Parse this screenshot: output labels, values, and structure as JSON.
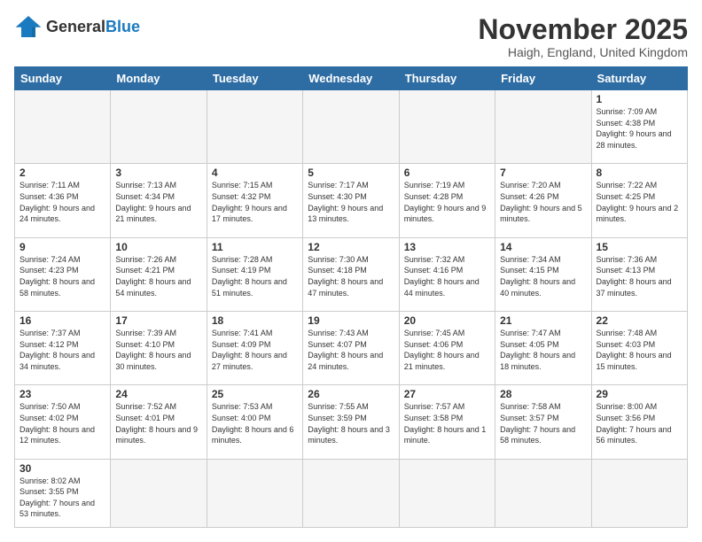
{
  "logo": {
    "general": "General",
    "blue": "Blue"
  },
  "title": "November 2025",
  "location": "Haigh, England, United Kingdom",
  "days_header": [
    "Sunday",
    "Monday",
    "Tuesday",
    "Wednesday",
    "Thursday",
    "Friday",
    "Saturday"
  ],
  "weeks": [
    [
      {
        "day": "",
        "info": ""
      },
      {
        "day": "",
        "info": ""
      },
      {
        "day": "",
        "info": ""
      },
      {
        "day": "",
        "info": ""
      },
      {
        "day": "",
        "info": ""
      },
      {
        "day": "",
        "info": ""
      },
      {
        "day": "1",
        "info": "Sunrise: 7:09 AM\nSunset: 4:38 PM\nDaylight: 9 hours and 28 minutes."
      }
    ],
    [
      {
        "day": "2",
        "info": "Sunrise: 7:11 AM\nSunset: 4:36 PM\nDaylight: 9 hours and 24 minutes."
      },
      {
        "day": "3",
        "info": "Sunrise: 7:13 AM\nSunset: 4:34 PM\nDaylight: 9 hours and 21 minutes."
      },
      {
        "day": "4",
        "info": "Sunrise: 7:15 AM\nSunset: 4:32 PM\nDaylight: 9 hours and 17 minutes."
      },
      {
        "day": "5",
        "info": "Sunrise: 7:17 AM\nSunset: 4:30 PM\nDaylight: 9 hours and 13 minutes."
      },
      {
        "day": "6",
        "info": "Sunrise: 7:19 AM\nSunset: 4:28 PM\nDaylight: 9 hours and 9 minutes."
      },
      {
        "day": "7",
        "info": "Sunrise: 7:20 AM\nSunset: 4:26 PM\nDaylight: 9 hours and 5 minutes."
      },
      {
        "day": "8",
        "info": "Sunrise: 7:22 AM\nSunset: 4:25 PM\nDaylight: 9 hours and 2 minutes."
      }
    ],
    [
      {
        "day": "9",
        "info": "Sunrise: 7:24 AM\nSunset: 4:23 PM\nDaylight: 8 hours and 58 minutes."
      },
      {
        "day": "10",
        "info": "Sunrise: 7:26 AM\nSunset: 4:21 PM\nDaylight: 8 hours and 54 minutes."
      },
      {
        "day": "11",
        "info": "Sunrise: 7:28 AM\nSunset: 4:19 PM\nDaylight: 8 hours and 51 minutes."
      },
      {
        "day": "12",
        "info": "Sunrise: 7:30 AM\nSunset: 4:18 PM\nDaylight: 8 hours and 47 minutes."
      },
      {
        "day": "13",
        "info": "Sunrise: 7:32 AM\nSunset: 4:16 PM\nDaylight: 8 hours and 44 minutes."
      },
      {
        "day": "14",
        "info": "Sunrise: 7:34 AM\nSunset: 4:15 PM\nDaylight: 8 hours and 40 minutes."
      },
      {
        "day": "15",
        "info": "Sunrise: 7:36 AM\nSunset: 4:13 PM\nDaylight: 8 hours and 37 minutes."
      }
    ],
    [
      {
        "day": "16",
        "info": "Sunrise: 7:37 AM\nSunset: 4:12 PM\nDaylight: 8 hours and 34 minutes."
      },
      {
        "day": "17",
        "info": "Sunrise: 7:39 AM\nSunset: 4:10 PM\nDaylight: 8 hours and 30 minutes."
      },
      {
        "day": "18",
        "info": "Sunrise: 7:41 AM\nSunset: 4:09 PM\nDaylight: 8 hours and 27 minutes."
      },
      {
        "day": "19",
        "info": "Sunrise: 7:43 AM\nSunset: 4:07 PM\nDaylight: 8 hours and 24 minutes."
      },
      {
        "day": "20",
        "info": "Sunrise: 7:45 AM\nSunset: 4:06 PM\nDaylight: 8 hours and 21 minutes."
      },
      {
        "day": "21",
        "info": "Sunrise: 7:47 AM\nSunset: 4:05 PM\nDaylight: 8 hours and 18 minutes."
      },
      {
        "day": "22",
        "info": "Sunrise: 7:48 AM\nSunset: 4:03 PM\nDaylight: 8 hours and 15 minutes."
      }
    ],
    [
      {
        "day": "23",
        "info": "Sunrise: 7:50 AM\nSunset: 4:02 PM\nDaylight: 8 hours and 12 minutes."
      },
      {
        "day": "24",
        "info": "Sunrise: 7:52 AM\nSunset: 4:01 PM\nDaylight: 8 hours and 9 minutes."
      },
      {
        "day": "25",
        "info": "Sunrise: 7:53 AM\nSunset: 4:00 PM\nDaylight: 8 hours and 6 minutes."
      },
      {
        "day": "26",
        "info": "Sunrise: 7:55 AM\nSunset: 3:59 PM\nDaylight: 8 hours and 3 minutes."
      },
      {
        "day": "27",
        "info": "Sunrise: 7:57 AM\nSunset: 3:58 PM\nDaylight: 8 hours and 1 minute."
      },
      {
        "day": "28",
        "info": "Sunrise: 7:58 AM\nSunset: 3:57 PM\nDaylight: 7 hours and 58 minutes."
      },
      {
        "day": "29",
        "info": "Sunrise: 8:00 AM\nSunset: 3:56 PM\nDaylight: 7 hours and 56 minutes."
      }
    ],
    [
      {
        "day": "30",
        "info": "Sunrise: 8:02 AM\nSunset: 3:55 PM\nDaylight: 7 hours and 53 minutes."
      },
      {
        "day": "",
        "info": ""
      },
      {
        "day": "",
        "info": ""
      },
      {
        "day": "",
        "info": ""
      },
      {
        "day": "",
        "info": ""
      },
      {
        "day": "",
        "info": ""
      },
      {
        "day": "",
        "info": ""
      }
    ]
  ]
}
